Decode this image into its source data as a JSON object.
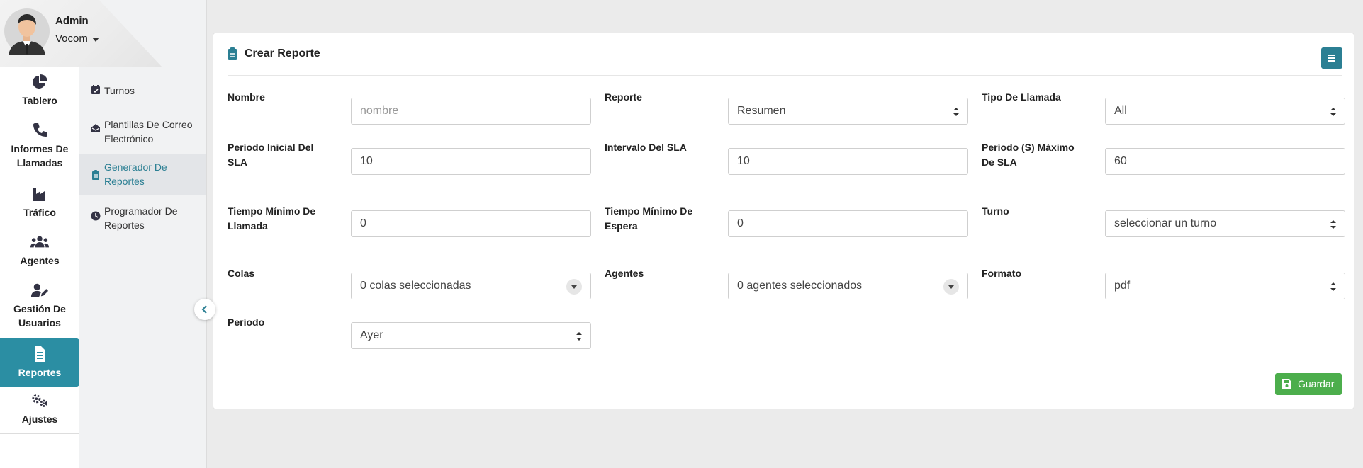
{
  "user": {
    "name": "Admin",
    "company": "Vocom"
  },
  "nav": {
    "items": [
      {
        "label": "Tablero",
        "icon": "pie-chart-icon"
      },
      {
        "label": "Informes De Llamadas",
        "icon": "phone-icon"
      },
      {
        "label": "Tráfico",
        "icon": "factory-icon"
      },
      {
        "label": "Agentes",
        "icon": "users-icon"
      },
      {
        "label": "Gestión De Usuarios",
        "icon": "user-edit-icon"
      },
      {
        "label": "Reportes",
        "icon": "file-text-icon"
      },
      {
        "label": "Ajustes",
        "icon": "gears-icon"
      }
    ],
    "active": "Reportes"
  },
  "submenu": {
    "items": [
      {
        "label": "Turnos",
        "icon": "calendar-check-icon"
      },
      {
        "label": "Plantillas De Correo Electrónico",
        "icon": "envelope-open-icon"
      },
      {
        "label": "Generador De Reportes",
        "icon": "clipboard-icon"
      },
      {
        "label": "Programador De Reportes",
        "icon": "clock-icon"
      }
    ],
    "active": "Generador De Reportes"
  },
  "card": {
    "title": "Crear Reporte",
    "save_label": "Guardar"
  },
  "form": {
    "nombre": {
      "label": "Nombre",
      "placeholder": "nombre"
    },
    "reporte": {
      "label": "Reporte",
      "value": "Resumen"
    },
    "tipo_llamada": {
      "label": "Tipo De Llamada",
      "value": "All"
    },
    "periodo_inicial": {
      "label": "Período Inicial Del SLA",
      "value": "10"
    },
    "intervalo": {
      "label": "Intervalo Del SLA",
      "value": "10"
    },
    "periodo_maximo": {
      "label": "Período (S) Máximo De SLA",
      "value": "60"
    },
    "tiempo_llamada": {
      "label": "Tiempo Mínimo De Llamada",
      "value": "0"
    },
    "tiempo_espera": {
      "label": "Tiempo Mínimo De Espera",
      "value": "0"
    },
    "turno": {
      "label": "Turno",
      "value": "seleccionar un turno"
    },
    "colas": {
      "label": "Colas",
      "value": "0 colas seleccionadas"
    },
    "agentes": {
      "label": "Agentes",
      "value": "0 agentes seleccionados"
    },
    "formato": {
      "label": "Formato",
      "value": "pdf"
    },
    "periodo": {
      "label": "Período",
      "value": "Ayer"
    }
  },
  "colors": {
    "accent": "#2b8ea3",
    "accent_dark": "#2b7f93",
    "success": "#4cae4c"
  }
}
